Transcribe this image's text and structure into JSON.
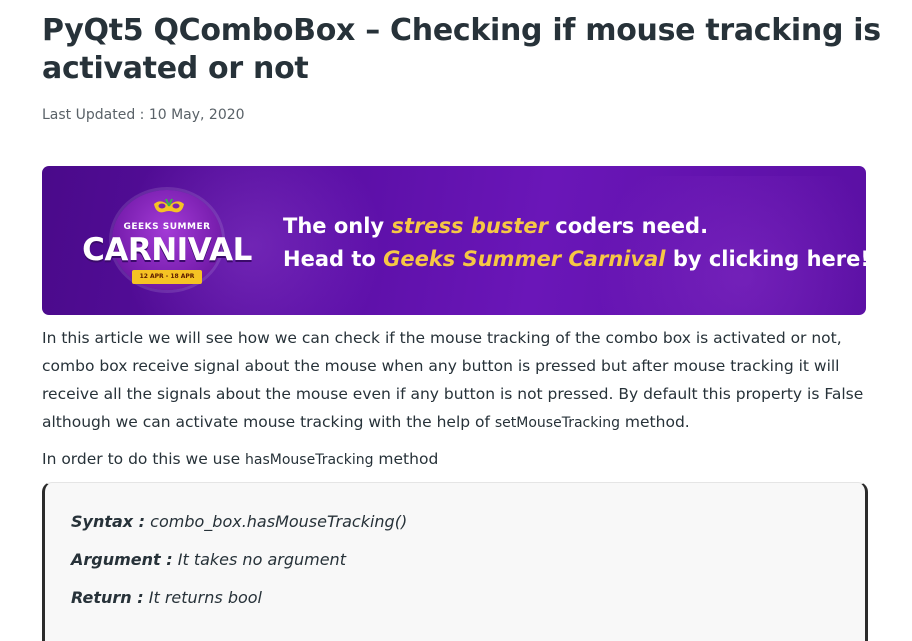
{
  "article": {
    "title": "PyQt5 QComboBox – Checking if mouse tracking is activated or not",
    "updated_label": "Last Updated : ",
    "updated_date": "10 May, 2020"
  },
  "banner": {
    "badge_top": "GEEKS SUMMER",
    "badge_main": "CARNIVAL",
    "badge_dates": "12 APR - 18 APR",
    "line1_pre": "The only ",
    "line1_highlight": "stress buster",
    "line1_post": " coders need.",
    "line2_pre": "Head to ",
    "line2_highlight": "Geeks Summer Carnival",
    "line2_post": " by clicking here!",
    "accent_color": "#f6c744",
    "bg_color": "#5b0fa6"
  },
  "body": {
    "para1_text": "In this article we will see how we can check if the mouse tracking of the combo box is activated or not, combo box receive signal about the mouse when any button is pressed but after mouse tracking it will receive all the signals about the mouse even if any button is not pressed. By default this property is False although we can activate mouse tracking with the help of ",
    "para1_code": "setMouseTracking",
    "para1_end": " method.",
    "para2_text": "In order to do this we use ",
    "para2_code": "hasMouseTracking",
    "para2_end": " method"
  },
  "syntax": {
    "syntax_label": "Syntax :",
    "syntax_value": " combo_box.hasMouseTracking()",
    "argument_label": "Argument :",
    "argument_value": " It takes no argument",
    "return_label": "Return :",
    "return_value": " It returns bool"
  }
}
